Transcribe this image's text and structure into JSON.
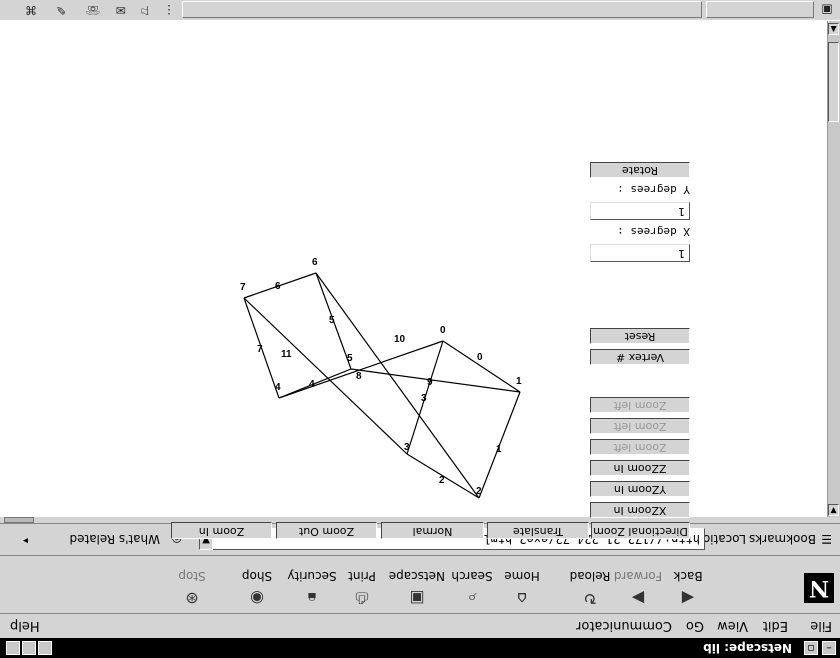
{
  "window": {
    "title": "Netscape: lib"
  },
  "menubar": {
    "items": [
      "File",
      "Edit",
      "View",
      "Go",
      "Communicator"
    ],
    "help": "Help"
  },
  "toolbar": {
    "buttons": [
      {
        "label": "Back",
        "icon": "back-arrow-icon"
      },
      {
        "label": "Forward",
        "icon": "forward-arrow-icon"
      },
      {
        "label": "Reload",
        "icon": "reload-icon"
      },
      {
        "label": "Home",
        "icon": "home-icon"
      },
      {
        "label": "Search",
        "icon": "search-icon"
      },
      {
        "label": "Netscape",
        "icon": "netscape-icon"
      },
      {
        "label": "Print",
        "icon": "print-icon"
      },
      {
        "label": "Security",
        "icon": "security-lock-icon"
      },
      {
        "label": "Shop",
        "icon": "shop-icon"
      },
      {
        "label": "Stop",
        "icon": "stop-icon"
      }
    ]
  },
  "location": {
    "bookmarks": "Bookmarks",
    "label": "Location:",
    "url": "http://172.21.224.72/exe2.html",
    "related": "What's Related"
  },
  "applet": {
    "rotate": "Rotate",
    "y_label": "Y degrees :",
    "y_value": "1",
    "x_label": "X degrees :",
    "x_value": "1",
    "reset": "Reset",
    "vertex": "Vertex #",
    "zoom_side": [
      "Zoom left",
      "Zoom left",
      "Zoom left",
      "ZZoom In",
      "YZoom In",
      "XZoom In"
    ],
    "bottom": [
      "Zoom In",
      "Zoom Out",
      "Normal",
      "Translate",
      "Directional Zoom"
    ],
    "vertex_labels": [
      "0",
      "1",
      "2",
      "3",
      "4",
      "5",
      "6",
      "7"
    ],
    "edge_labels": [
      "0",
      "1",
      "2",
      "3",
      "4",
      "5",
      "6",
      "7",
      "8",
      "9",
      "10",
      "11"
    ]
  }
}
